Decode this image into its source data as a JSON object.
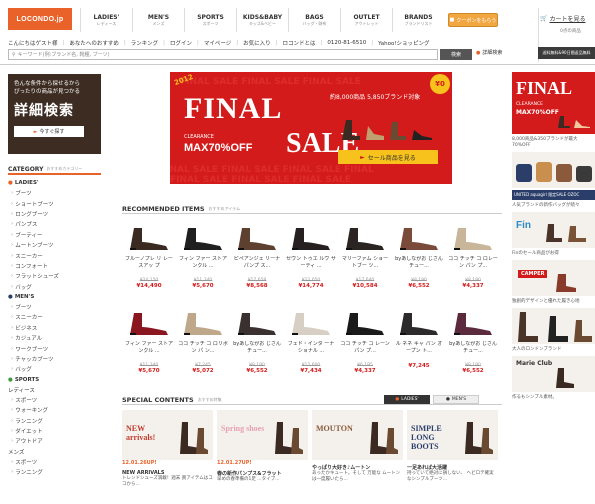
{
  "logo": "LOCONDO.jp",
  "topnav": [
    {
      "main": "LADIES'",
      "sub": "レディース"
    },
    {
      "main": "MEN'S",
      "sub": "メンズ"
    },
    {
      "main": "SPORTS",
      "sub": "スポーツ"
    },
    {
      "main": "KIDS&BABY",
      "sub": "キッズ&ベビー"
    },
    {
      "main": "BAGS",
      "sub": "バッグ・財布"
    },
    {
      "main": "OUTLET",
      "sub": "アウトレット"
    },
    {
      "main": "BRANDS",
      "sub": "ブランドリスト"
    }
  ],
  "coupon": "クーポンをもらう",
  "cart": {
    "label": "カートを見る",
    "sub": "0点の商品",
    "shipping": "送料無料&90日間返品無料"
  },
  "subnav": [
    "こんにちはゲスト様",
    "あなたへのおすすめ",
    "ランキング",
    "ログイン",
    "マイページ",
    "お気に入り",
    "ロコンドとは",
    "0120-81-6510",
    "Yahoo!ショッピング"
  ],
  "search": {
    "placeholder": "キーワード(例:ブランド名, 靴種, ブーツ)",
    "button": "検索",
    "advanced": "詳細検索"
  },
  "detail_box": {
    "line1": "色んな条件から探せるから",
    "line2": "ぴったりの商品が見つかる",
    "big": "詳細検索",
    "button": "今すぐ探す"
  },
  "category": {
    "title": "CATEGORY",
    "sub": "おすすめカテゴリー",
    "ladies_title": "LADIES'",
    "ladies": [
      "ブーツ",
      "ショートブーツ",
      "ロングブーツ",
      "パンプス",
      "ブーティー",
      "ムートンブーツ",
      "スニーカー",
      "コンフォート",
      "フラットシューズ",
      "バッグ"
    ],
    "mens_title": "MEN'S",
    "mens": [
      "ブーツ",
      "スニーカー",
      "ビジネス",
      "カジュアル",
      "ワークブーツ",
      "チャッカブーツ",
      "バッグ"
    ],
    "sports_title": "SPORTS",
    "sports_sub": "レディース",
    "sports": [
      "スポーツ",
      "ウォーキング",
      "ランニング",
      "ダイエット",
      "アウトドア"
    ],
    "mens2_title": "メンズ",
    "mens2": [
      "スポーツ",
      "ランニング"
    ]
  },
  "hero": {
    "year": "2012",
    "final": "FINAL",
    "clearance": "CLEARANCE",
    "max": "MAX70%OFF",
    "sale": "SALE",
    "offer": "約8,000商品 5,850ブランド対象",
    "badge": "¥0",
    "cta": "セール商品を見る"
  },
  "recommended": {
    "title": "RECOMMENDED ITEMS",
    "sub": "おすすめアイテム"
  },
  "products": [
    [
      {
        "name": "ブルーノプレ リ レースアッ プ",
        "old": "¥24,150",
        "price": "¥14,490",
        "color": "#3a2a22"
      },
      {
        "name": "フィン ファー ストアンクル ...",
        "old": "¥11,340",
        "price": "¥5,670",
        "color": "#1f1f1f"
      },
      {
        "name": "ピペアンジェ リーナ パンプ ス...",
        "old": "¥17,658",
        "price": "¥8,568",
        "color": "#5e4030"
      },
      {
        "name": "セヴン トゥエ ルヴ サーティ ...",
        "old": "¥22,050",
        "price": "¥14,774",
        "color": "#262020"
      },
      {
        "name": "マリーファム ショートブー ツ...",
        "old": "¥17,640",
        "price": "¥10,584",
        "color": "#2a2423"
      },
      {
        "name": "byあしながお じさん チュー...",
        "old": "¥8,190",
        "price": "¥6,552",
        "color": "#7a4a3a"
      },
      {
        "name": "ココ チッチ コ ロレーン パン プ...",
        "old": "¥8,190",
        "price": "¥4,337",
        "color": "#c9b59a"
      }
    ],
    [
      {
        "name": "フィン ファー ストアンクル ...",
        "old": "¥11,340",
        "price": "¥5,670",
        "color": "#8a1620"
      },
      {
        "name": "ココ チッチ コ ロリボン パ ン...",
        "old": "¥7,245",
        "price": "¥5,072",
        "color": "#bfa88a"
      },
      {
        "name": "byあしながお じさん チュー...",
        "old": "¥8,190",
        "price": "¥6,552",
        "color": "#3a3030"
      },
      {
        "name": "フェド・インタ ーナショナル ...",
        "old": "¥12,600",
        "price": "¥7,434",
        "color": "#d8cfc4"
      },
      {
        "name": "ココ チッチ コ レーンパン プ...",
        "old": "¥6,195",
        "price": "¥4,337",
        "color": "#1a1a1a"
      },
      {
        "name": "ル ネネ キャ パン オープン ト...",
        "old": "",
        "price": "¥7,245",
        "color": "#2c2a2a"
      },
      {
        "name": "byあしながお じさん チュー...",
        "old": "¥8,190",
        "price": "¥6,552",
        "color": "#5b2a3c"
      }
    ]
  ],
  "special": {
    "title": "SPECIAL CONTENTS",
    "sub": "おすすめ特集",
    "tab_ladies": "LADIES'",
    "tab_mens": "MEN'S"
  },
  "specials": [
    {
      "img": "NEW arrivals!",
      "date": "12.01.26UP!",
      "title": "NEW ARRIVALS",
      "desc": "トレンドシューズ満載！週末 買アイテムはココから..."
    },
    {
      "img": "Spring shoes",
      "date": "12.01.27UP!",
      "title": "春の新作パンプス&フラット",
      "desc": "早めの春準備の1足 ...タイプ..."
    },
    {
      "img": "MOUTON",
      "date": "",
      "title": "やっぱり大好き♪ムートン",
      "desc": "あったかキュート。そして 万能な ムートンは一度履いたら..."
    },
    {
      "img": "SIMPLE LONG BOOTS",
      "date": "",
      "title": "一足あれば大活躍",
      "desc": "持っていて絶対に損しない、 ヘビロテ確実なシンプルブーツ..."
    }
  ],
  "right": {
    "final": "FINAL",
    "clearance": "CLEARANCE",
    "max": "MAX70%OFF",
    "txt1": "8,000商品&350ブランドが最大70%OFF",
    "brand": "UNITED aquagirl 限定SALE OZOC",
    "txt2": "人気ブランドの新作バッグが続々",
    "txt3": "Finのセール商品がお得",
    "txt4": "独創的デザインと優れた履き心地",
    "txt5": "大人のロンドンブランド",
    "marie": "Marie Club",
    "txt6": "作るもシンプル素材。"
  },
  "colors": {
    "accent": "#e8622a",
    "hero_red": "#d41b1b",
    "yellow": "#f7c21c",
    "dark_brown": "#3d2c22"
  }
}
